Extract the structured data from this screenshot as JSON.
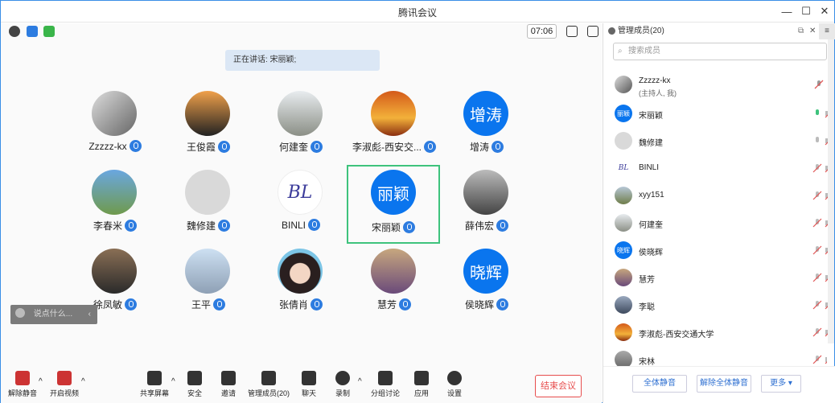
{
  "window": {
    "title": "腾讯会议"
  },
  "topbar": {
    "timer": "07:06"
  },
  "speaking": "正在讲话: 宋丽颖;",
  "tiles": [
    {
      "name": "Zzzzz-kx",
      "avatar": "photo-woman-room"
    },
    {
      "name": "王俊霞",
      "avatar": "photo-tree-sunset"
    },
    {
      "name": "何建奎",
      "avatar": "photo-pagoda"
    },
    {
      "name": "李淑彪-西安交...",
      "avatar": "photo-sunset-sea"
    },
    {
      "name": "增涛",
      "avatar_text": "增涛"
    },
    {
      "name": "李春米",
      "avatar": "photo-grassland"
    },
    {
      "name": "魏修建",
      "avatar": "default-person"
    },
    {
      "name": "BINLI",
      "avatar_text": "BL"
    },
    {
      "name": "宋丽颖",
      "avatar_text": "丽颖"
    },
    {
      "name": "薛伟宏",
      "avatar": "photo-man-hat"
    },
    {
      "name": "徐凤敏",
      "avatar": "photo-woman-smile"
    },
    {
      "name": "王平",
      "avatar": "photo-building"
    },
    {
      "name": "张倩肖",
      "avatar": "cartoon-woman-glasses"
    },
    {
      "name": "慧芳",
      "avatar": "photo-woman-field"
    },
    {
      "name": "侯晓辉",
      "avatar_text": "晓辉"
    }
  ],
  "chat_placeholder": "说点什么...",
  "toolbar": {
    "unmute": "解除静音",
    "video": "开启视频",
    "share": "共享屏幕",
    "security": "安全",
    "invite": "邀请",
    "members": "管理成员(20)",
    "chat": "聊天",
    "record": "录制",
    "breakout": "分组讨论",
    "apps": "应用",
    "settings": "设置",
    "end": "结束会议"
  },
  "panel": {
    "title": "管理成员(20)",
    "search_placeholder": "搜索成员",
    "members": [
      {
        "name": "Zzzzz-kx",
        "sub": "(主持人, 我)"
      },
      {
        "name": "宋丽颖",
        "avatar_text": "丽颖"
      },
      {
        "name": "魏修建"
      },
      {
        "name": "BINLI",
        "avatar_text": "BL"
      },
      {
        "name": "xyy151"
      },
      {
        "name": "何建奎"
      },
      {
        "name": "侯晓辉",
        "avatar_text": "晓辉"
      },
      {
        "name": "慧芳"
      },
      {
        "name": "李聪"
      },
      {
        "name": "李淑彪-西安交通大学"
      },
      {
        "name": "宋林"
      }
    ],
    "mute_all": "全体静音",
    "unmute_all": "解除全体静音",
    "more": "更多 ▾"
  },
  "colors": {
    "accent": "#0a75ee",
    "active_border": "#3ec37c",
    "end_red": "#e74d4d"
  }
}
